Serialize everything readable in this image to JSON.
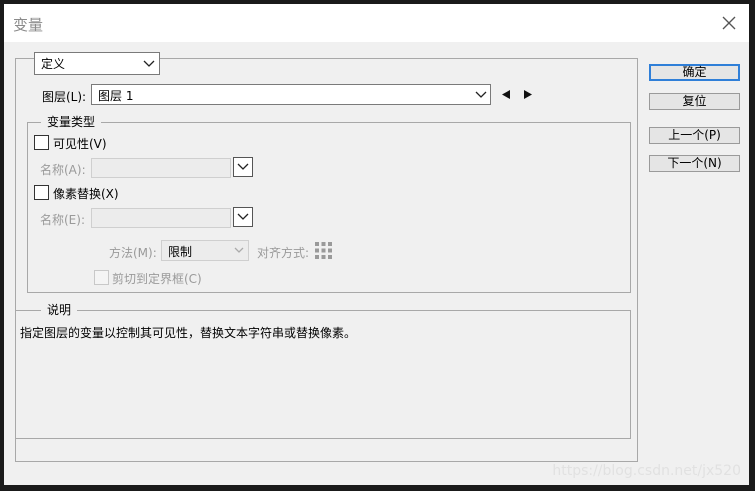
{
  "window": {
    "title": "变量"
  },
  "definition_select": {
    "value": "定义"
  },
  "layer": {
    "label": "图层(L):",
    "value": "图层 1"
  },
  "variable_types": {
    "group_label": "变量类型",
    "visibility": {
      "label": "可见性(V)",
      "name_label": "名称(A):"
    },
    "pixel_replace": {
      "label": "像素替换(X)",
      "name_label": "名称(E):"
    },
    "method": {
      "label": "方法(M):",
      "value": "限制"
    },
    "alignment": {
      "label": "对齐方式:"
    },
    "clip": {
      "label": "剪切到定界框(C)"
    }
  },
  "description": {
    "group_label": "说明",
    "text": "指定图层的变量以控制其可见性，替换文本字符串或替换像素。"
  },
  "buttons": {
    "ok": "确定",
    "reset": "复位",
    "prev": "上一个(P)",
    "next": "下一个(N)"
  },
  "watermark": "https://blog.csdn.net/jx520"
}
